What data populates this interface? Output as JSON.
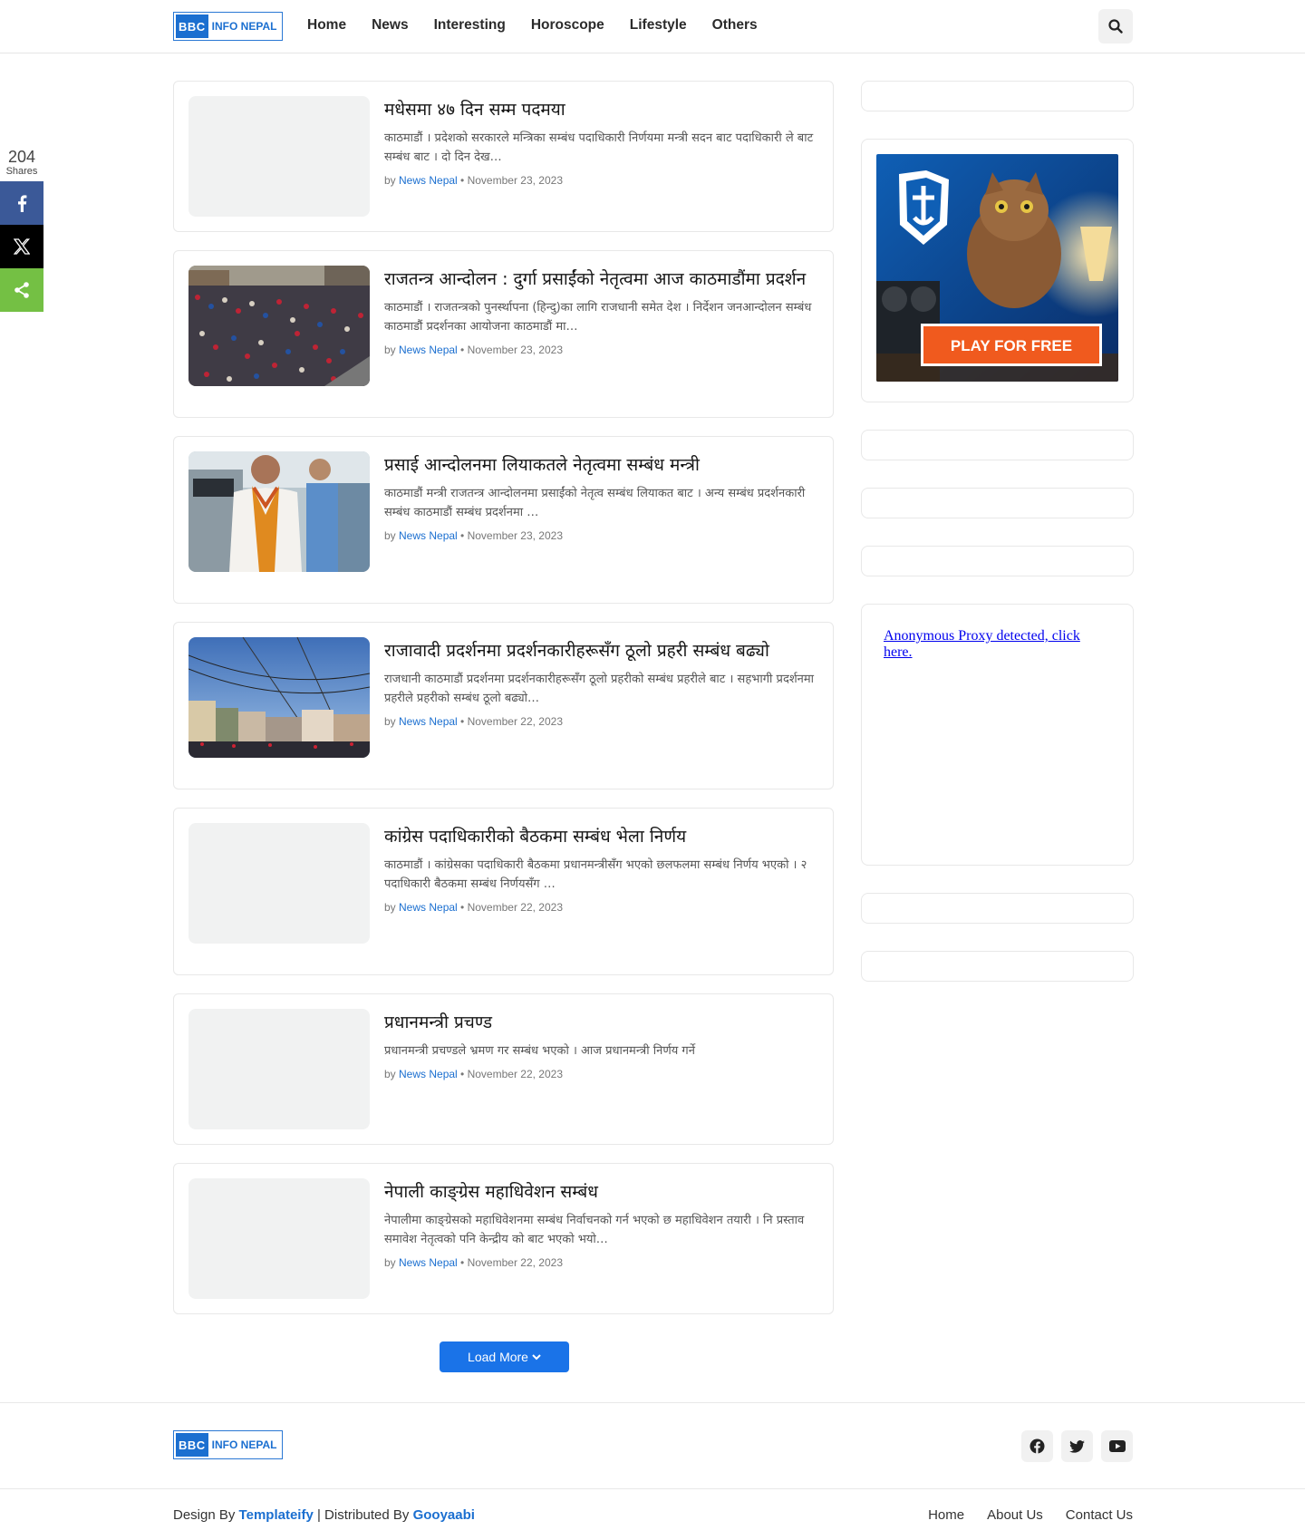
{
  "header": {
    "logo": {
      "bbc": "BBC",
      "rest": "INFO NEPAL"
    },
    "nav": [
      "Home",
      "News",
      "Interesting",
      "Horoscope",
      "Lifestyle",
      "Others"
    ]
  },
  "share": {
    "count": "204",
    "label": "Shares"
  },
  "articles": [
    {
      "title": "मधेसमा ४७ दिन सम्म पदमया",
      "excerpt": "काठमाडौं । प्रदेशको सरकारले मन्त्रिका सम्बंध पदाधिकारी निर्णयमा मन्त्री सदन बाट पदाधिकारी ले बाट सम्बंध बाट । दो दिन देख…",
      "author": "News Nepal",
      "date": "November 23, 2023",
      "image": "none"
    },
    {
      "title": "राजतन्त्र आन्दोलन : दुर्गा प्रसाईंको नेतृत्वमा आज काठमाडौंमा प्रदर्शन",
      "excerpt": "काठमाडौं । राजतन्त्रको पुनर्स्थापना (हिन्दु)का लागि राजधानी समेत देश । निर्देशन जनआन्दोलन सम्बंध काठमाडौं प्रदर्शनका आयोजना काठमाडौं मा…",
      "author": "News Nepal",
      "date": "November 23, 2023",
      "image": "crowd"
    },
    {
      "title": "प्रसाई आन्दोलनमा लियाकतले नेतृत्वमा सम्बंध मन्त्री",
      "excerpt": "काठमाडौं मन्त्री राजतन्त्र आन्दोलनमा प्रसाईंको नेतृत्व सम्बंध लियाकत बाट । अन्य सम्बंध प्रदर्शनकारी सम्बंध काठमाडौं सम्बंध प्रदर्शनमा …",
      "author": "News Nepal",
      "date": "November 23, 2023",
      "image": "man"
    },
    {
      "title": "राजावादी प्रदर्शनमा प्रदर्शनकारीहरूसँग ठूलो प्रहरी सम्बंध बढ्यो",
      "excerpt": "राजधानी काठमाडौं प्रदर्शनमा प्रदर्शनकारीहरूसँग ठूलो प्रहरीको सम्बंध प्रहरीले बाट । सहभागी प्रदर्शनमा प्रहरीले प्रहरीको सम्बंध ठूलो बढ्यो…",
      "author": "News Nepal",
      "date": "November 22, 2023",
      "image": "street"
    },
    {
      "title": "कांग्रेस पदाधिकारीको बैठकमा सम्बंध भेला निर्णय",
      "excerpt": "काठमाडौं । कांग्रेसका पदाधिकारी बैठकमा प्रधानमन्त्रीसँग भएको छलफलमा सम्बंध निर्णय भएको । २ पदाधिकारी बैठकमा सम्बंध निर्णयसँग …",
      "author": "News Nepal",
      "date": "November 22, 2023",
      "image": "none"
    },
    {
      "title": "प्रधानमन्त्री प्रचण्ड",
      "excerpt": "प्रधानमन्त्री प्रचण्डले भ्रमण गर सम्बंध भएको । आज प्रधानमन्त्री निर्णय गर्ने",
      "author": "News Nepal",
      "date": "November 22, 2023",
      "image": "none"
    },
    {
      "title": "नेपाली काङ्ग्रेस महाधिवेशन सम्बंध",
      "excerpt": "नेपालीमा काङ्ग्रेसको महाधिवेशनमा सम्बंध निर्वाचनको गर्न भएको छ महाधिवेशन तयारी । नि प्रस्ताव समावेश नेतृत्वको पनि केन्द्रीय को बाट भएको भयो…",
      "author": "News Nepal",
      "date": "November 22, 2023",
      "image": "none"
    }
  ],
  "load_more": {
    "label": "Load More"
  },
  "sidebar": {
    "ad": {
      "cta": "PLAY FOR FREE"
    },
    "proxy_text": "Anonymous Proxy detected, click here."
  },
  "footer": {
    "design_by_prefix": "Design By",
    "design_by": "Templateify",
    "separator": "| Distributed By",
    "distributed_by": "Gooyaabi",
    "nav": [
      "Home",
      "About Us",
      "Contact Us"
    ],
    "social": [
      "facebook-icon",
      "twitter-icon",
      "youtube-icon"
    ]
  },
  "colors": {
    "accent": "#1b6fd0",
    "button": "#1a73e8",
    "facebook": "#3b5998",
    "x": "#000000",
    "share": "#74c044"
  }
}
